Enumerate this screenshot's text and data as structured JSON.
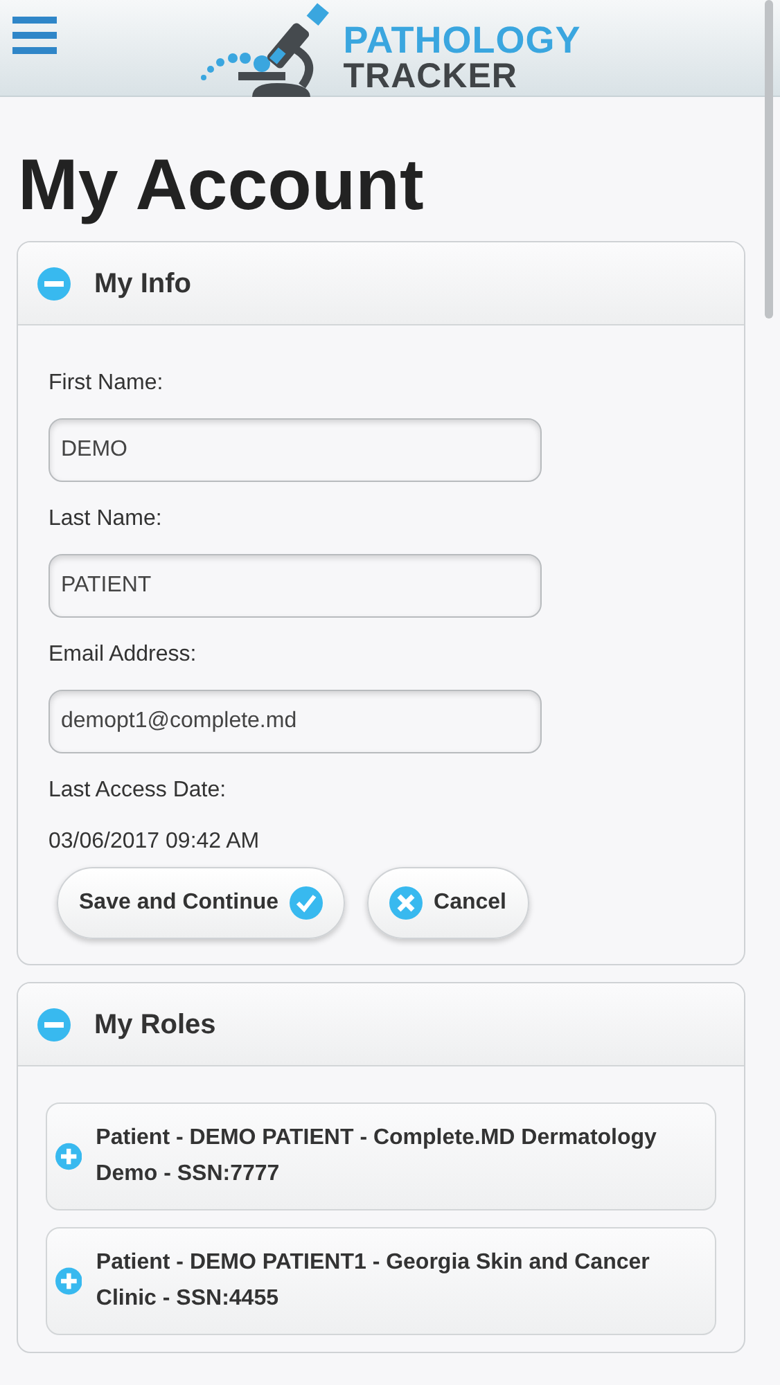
{
  "header": {
    "logo_line_1": "PATHOLOGY",
    "logo_line_2": "TRACKER"
  },
  "page_title": "My Account",
  "sections": [
    {
      "title": "My Info",
      "expanded": true,
      "fields": [
        {
          "label": "First Name:",
          "value": "DEMO"
        },
        {
          "label": "Last Name:",
          "value": "PATIENT"
        },
        {
          "label": "Email Address:",
          "value": "demopt1@complete.md"
        }
      ],
      "info": {
        "label": "Last Access Date:",
        "value": "03/06/2017 09:42 AM"
      },
      "buttons": [
        {
          "label": "Save and Continue",
          "kind": "save"
        },
        {
          "label": "Cancel",
          "kind": "cancel"
        }
      ]
    },
    {
      "title": "My Roles",
      "expanded": true,
      "roles": [
        {
          "text": "Patient - DEMO PATIENT - Complete.MD Dermatology Demo - SSN:7777",
          "expanded": false
        },
        {
          "text": "Patient - DEMO PATIENT1 - Georgia Skin and Cancer Clinic - SSN:4455",
          "expanded": false
        }
      ]
    }
  ]
}
